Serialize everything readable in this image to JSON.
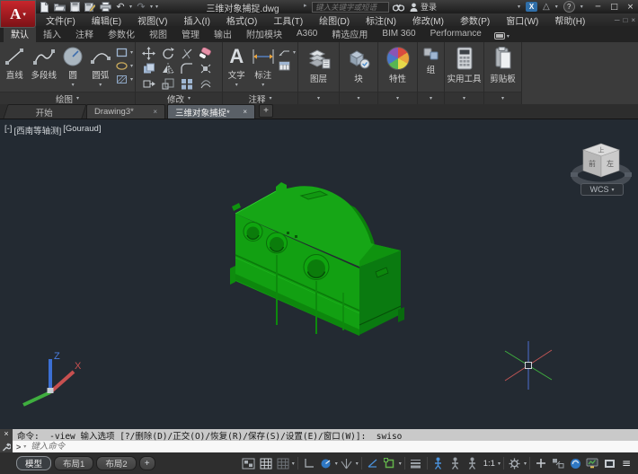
{
  "icons": {
    "caret_down": "▾",
    "flyout_right": "▸",
    "close": "×",
    "minimize": "─",
    "maximize": "□",
    "restore": "□",
    "plus": "+",
    "undo": "↶",
    "redo": "↷",
    "help": "?",
    "hamburger": "≡",
    "prompt": ">",
    "exchange_x": "X",
    "a360_triangle": "△",
    "text_tool_glyph": "A",
    "dash": "·"
  },
  "titlebar": {
    "logo": "A",
    "title": "三维对象捕捉.dwg",
    "search_placeholder": "键入关键字或短语",
    "signin_label": "登录"
  },
  "menubar": {
    "items": [
      "文件(F)",
      "编辑(E)",
      "视图(V)",
      "插入(I)",
      "格式(O)",
      "工具(T)",
      "绘图(D)",
      "标注(N)",
      "修改(M)",
      "参数(P)",
      "窗口(W)",
      "帮助(H)"
    ]
  },
  "ribbon": {
    "tabs": [
      "默认",
      "插入",
      "注释",
      "参数化",
      "视图",
      "管理",
      "输出",
      "附加模块",
      "A360",
      "精选应用",
      "BIM 360",
      "Performance"
    ],
    "draw": {
      "label": "绘图",
      "line": "直线",
      "polyline": "多段线",
      "circle": "圆",
      "arc": "圆弧"
    },
    "modify": {
      "label": "修改"
    },
    "annotate": {
      "label": "注释",
      "text": "文字",
      "dim": "标注"
    },
    "layers": {
      "label": "图层"
    },
    "block": {
      "label": "块"
    },
    "properties": {
      "label": "特性"
    },
    "group": {
      "label": "组"
    },
    "utilities": {
      "label": "实用工具"
    },
    "clipboard": {
      "label": "剪贴板"
    }
  },
  "file_tabs": {
    "start": "开始",
    "drawing": "Drawing3*",
    "active": "三维对象捕捉*"
  },
  "viewport": {
    "label_controls": "[-]",
    "label_view": "[西南等轴测]",
    "label_visual": "[Gouraud]",
    "viewcube": {
      "top": "上",
      "front": "前",
      "left": "左",
      "wcs": "WCS"
    },
    "ucs": {
      "x": "X",
      "z": "Z"
    }
  },
  "command": {
    "history": "命令: _-view 输入选项 [?/删除(D)/正交(O)/恢复(R)/保存(S)/设置(E)/窗口(W)]: _swiso",
    "placeholder": "键入命令"
  },
  "statusbar": {
    "layout_tabs": [
      "模型",
      "布局1",
      "布局2"
    ],
    "scale": "1:1"
  },
  "colors": {
    "model_green": "#12a012",
    "model_green_dark": "#0a7a10",
    "canvas_bg": "#232a32",
    "accent_blue": "#4a90d9",
    "osnap_green": "#63b24a",
    "logo_red": "#c8262c"
  }
}
